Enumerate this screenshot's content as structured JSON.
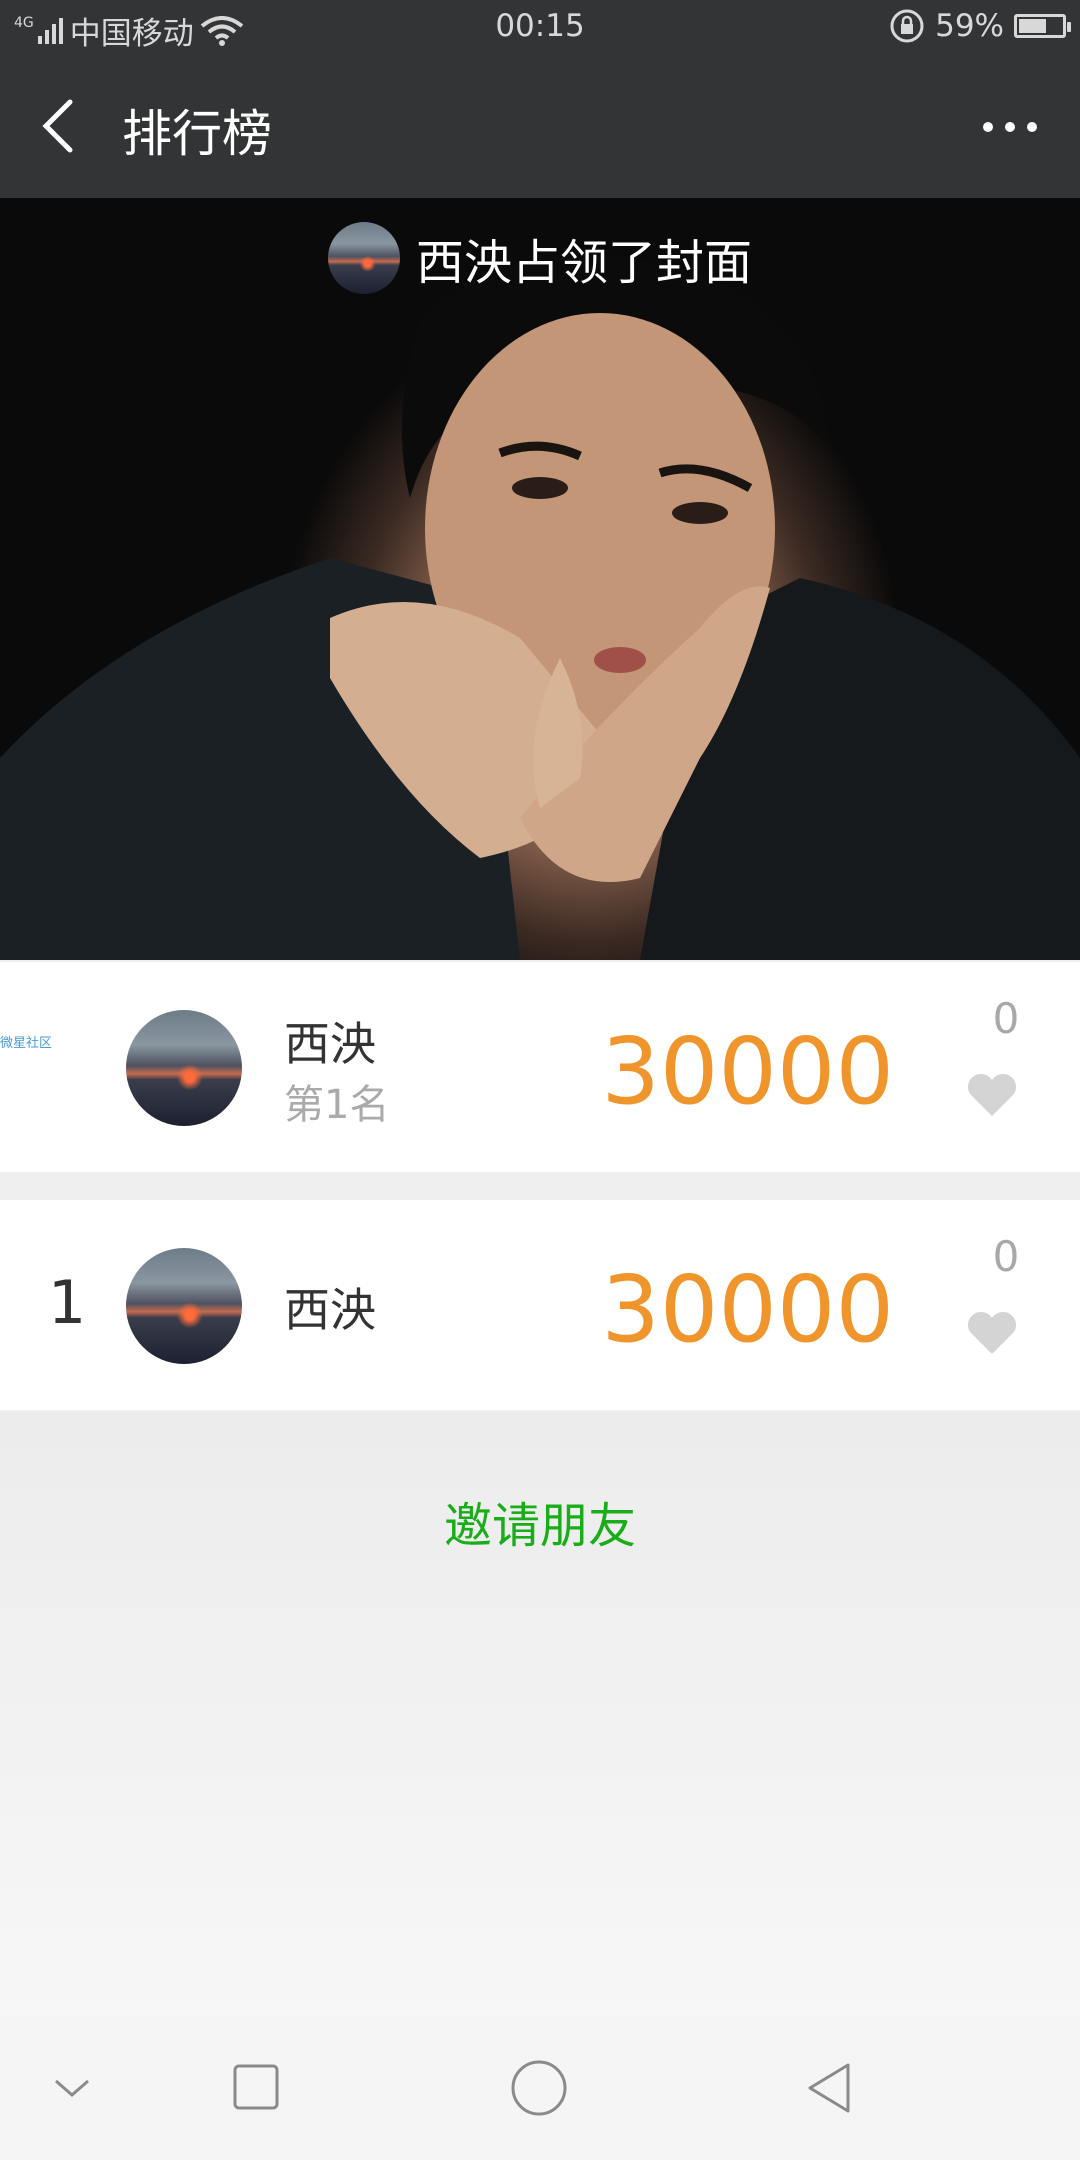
{
  "status_bar": {
    "network": "4G",
    "carrier": "中国移动",
    "time": "00:15",
    "battery_percent": "59%",
    "battery_level": 0.59
  },
  "nav": {
    "title": "排行榜",
    "back_icon": "chevron-left-icon",
    "more_icon": "more-dots-icon"
  },
  "cover": {
    "caption": "西泱占领了封面"
  },
  "my_rank": {
    "watermark": "微星社区",
    "name": "西泱",
    "rank_label": "第1名",
    "score": "30000",
    "likes": "0"
  },
  "leaderboard": [
    {
      "rank": "1",
      "name": "西泱",
      "score": "30000",
      "likes": "0"
    }
  ],
  "invite_label": "邀请朋友",
  "colors": {
    "score": "#f0952b",
    "invite": "#1aad19",
    "header_bg": "#333436"
  }
}
